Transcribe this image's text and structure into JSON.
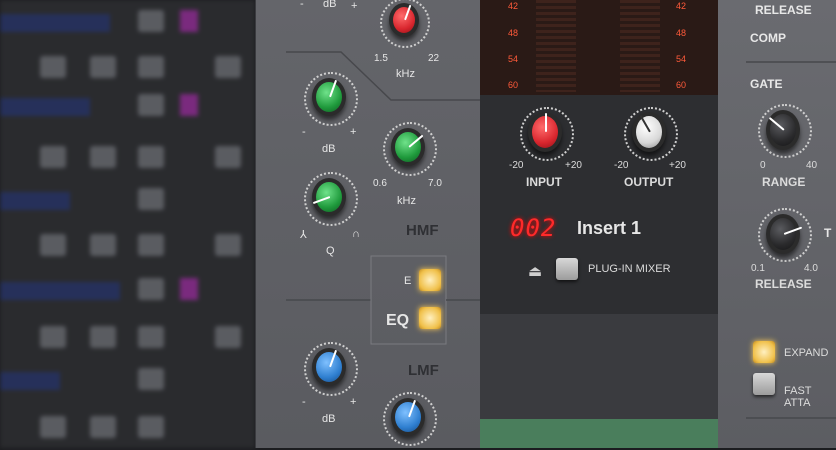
{
  "eq": {
    "db_top": "dB",
    "plus_top": "+",
    "hf_min": "1.5",
    "hf_max": "22",
    "khz_top": "kHz",
    "hmf_minus": "-",
    "hmf_plus": "+",
    "hmf_db": "dB",
    "hmf_min": "0.6",
    "hmf_max": "7.0",
    "hmf_khz": "kHz",
    "q_left": "⅄",
    "q_right": "∩",
    "q_label": "Q",
    "hmf_title": "HMF",
    "e_label": "E",
    "eq_label": "EQ",
    "lmf_title": "LMF",
    "lmf_minus": "-",
    "lmf_plus": "+",
    "lmf_db": "dB"
  },
  "meters": {
    "scale": [
      "42",
      "48",
      "54",
      "60"
    ]
  },
  "io": {
    "input_min": "-20",
    "input_max": "+20",
    "input_label": "INPUT",
    "output_min": "-20",
    "output_max": "+20",
    "output_label": "OUTPUT"
  },
  "insert": {
    "number": "002",
    "name": "Insert 1",
    "plugin_mixer": "PLUG-IN MIXER"
  },
  "right": {
    "release_top": "RELEASE",
    "comp": "COMP",
    "gate": "GATE",
    "range_min": "0",
    "range_max": "40",
    "range_label": "RANGE",
    "rel_min": "0.1",
    "rel_max": "4.0",
    "release_label": "RELEASE",
    "t_cut": "T",
    "expand": "EXPAND",
    "fast_att": "FAST ATTA"
  },
  "colors": {
    "red_knob": "#d9262e",
    "green_knob": "#1f9a3c",
    "blue_knob": "#2f7fd0",
    "led_red": "#ff2a2a",
    "amber": "#f0c04a"
  }
}
